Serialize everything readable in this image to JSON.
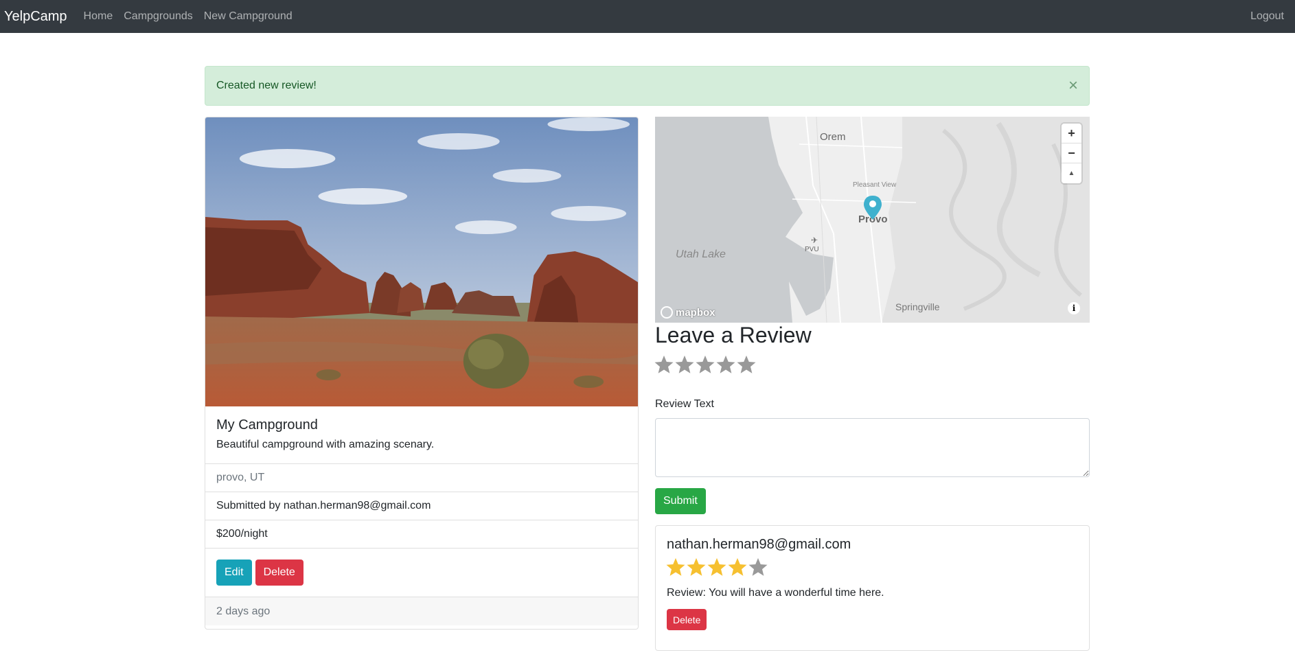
{
  "navbar": {
    "brand": "YelpCamp",
    "links": [
      "Home",
      "Campgrounds",
      "New Campground"
    ],
    "logout": "Logout"
  },
  "alert": {
    "message": "Created new review!",
    "close": "×"
  },
  "campground": {
    "title": "My Campground",
    "description": "Beautiful campground with amazing scenary.",
    "location": "provo, UT",
    "submitted_by": "Submitted by nathan.herman98@gmail.com",
    "price": "$200/night",
    "edit_label": "Edit",
    "delete_label": "Delete",
    "footer": "2 days ago"
  },
  "map": {
    "labels": {
      "orem": "Orem",
      "pleasant_view": "Pleasant View",
      "provo": "Provo",
      "utah_lake": "Utah Lake",
      "pvu": "PVU",
      "springville": "Springville"
    },
    "logo": "mapbox",
    "zoom_in": "+",
    "zoom_out": "−",
    "compass": "▲",
    "info": "i"
  },
  "review_form": {
    "heading": "Leave a Review",
    "rating": 0,
    "max_rating": 5,
    "text_label": "Review Text",
    "text_value": "",
    "submit_label": "Submit"
  },
  "reviews": [
    {
      "author": "nathan.herman98@gmail.com",
      "rating": 4,
      "max_rating": 5,
      "text": "Review: You will have a wonderful time here.",
      "delete_label": "Delete"
    }
  ],
  "colors": {
    "navbar": "#343a40",
    "alert_bg": "#d4edda",
    "alert_text": "#155724",
    "star_filled": "#f6c030",
    "star_empty": "#999999",
    "edit": "#17a2b8",
    "delete": "#dc3545",
    "submit": "#28a745",
    "marker": "#3fb1ce"
  }
}
